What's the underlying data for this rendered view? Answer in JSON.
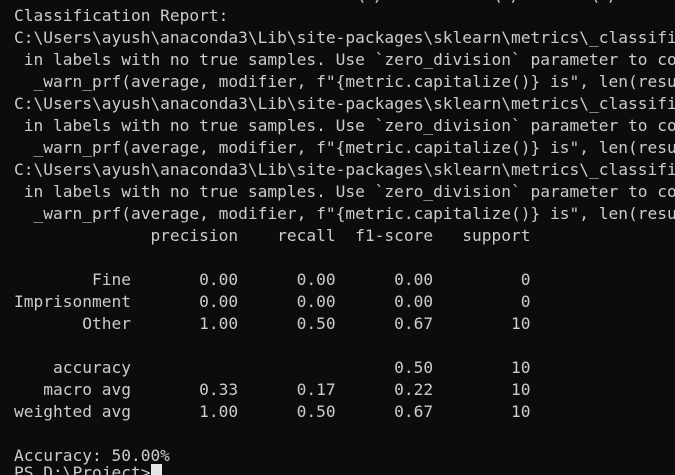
{
  "terminal": {
    "top_fragment": "                                   \\ /           \\ /       \\ /",
    "lines": [
      "Classification Report:",
      "C:\\Users\\ayush\\anaconda3\\Lib\\site-packages\\sklearn\\metrics\\_classification",
      " in labels with no true samples. Use `zero_division` parameter to control",
      "  _warn_prf(average, modifier, f\"{metric.capitalize()} is\", len(result))",
      "C:\\Users\\ayush\\anaconda3\\Lib\\site-packages\\sklearn\\metrics\\_classification",
      " in labels with no true samples. Use `zero_division` parameter to control",
      "  _warn_prf(average, modifier, f\"{metric.capitalize()} is\", len(result))",
      "C:\\Users\\ayush\\anaconda3\\Lib\\site-packages\\sklearn\\metrics\\_classification",
      " in labels with no true samples. Use `zero_division` parameter to control",
      "  _warn_prf(average, modifier, f\"{metric.capitalize()} is\", len(result))",
      "              precision    recall  f1-score   support",
      "",
      "        Fine       0.00      0.00      0.00         0",
      "Imprisonment       0.00      0.00      0.00         0",
      "       Other       1.00      0.50      0.67        10",
      "",
      "    accuracy                           0.50        10",
      "   macro avg       0.33      0.17      0.22        10",
      "weighted avg       1.00      0.50      0.67        10",
      "",
      "Accuracy: 50.00%"
    ],
    "prompt": "PS D:\\Project>"
  }
}
